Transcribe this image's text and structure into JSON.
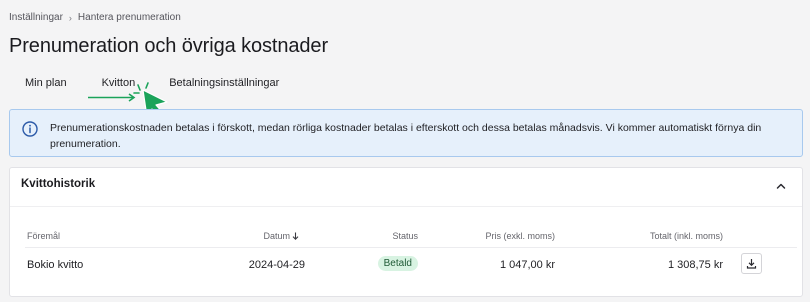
{
  "breadcrumb": {
    "items": [
      "Inställningar",
      "Hantera prenumeration"
    ]
  },
  "page_title": "Prenumeration och övriga kostnader",
  "tabs": [
    {
      "label": "Min plan"
    },
    {
      "label": "Kvitton"
    },
    {
      "label": "Betalningsinställningar"
    }
  ],
  "info_banner": {
    "text": "Prenumerationskostnaden betalas i förskott, medan rörliga kostnader betalas i efterskott och dessa betalas månadsvis. Vi kommer automatiskt förnya din prenumeration.",
    "icon": "info-icon"
  },
  "receipts": {
    "title": "Kvittohistorik",
    "columns": {
      "item": "Föremål",
      "date": "Datum",
      "status": "Status",
      "price": "Pris (exkl. moms)",
      "total": "Totalt (inkl. moms)"
    },
    "rows": [
      {
        "item": "Bokio kvitto",
        "date": "2024-04-29",
        "status": "Betald",
        "price": "1 047,00 kr",
        "total": "1 308,75 kr"
      }
    ]
  },
  "colors": {
    "accent_green": "#1aa35a",
    "info_border": "#a8c9ee",
    "info_bg": "#e6f0fb",
    "status_bg": "#d8f3e2"
  }
}
